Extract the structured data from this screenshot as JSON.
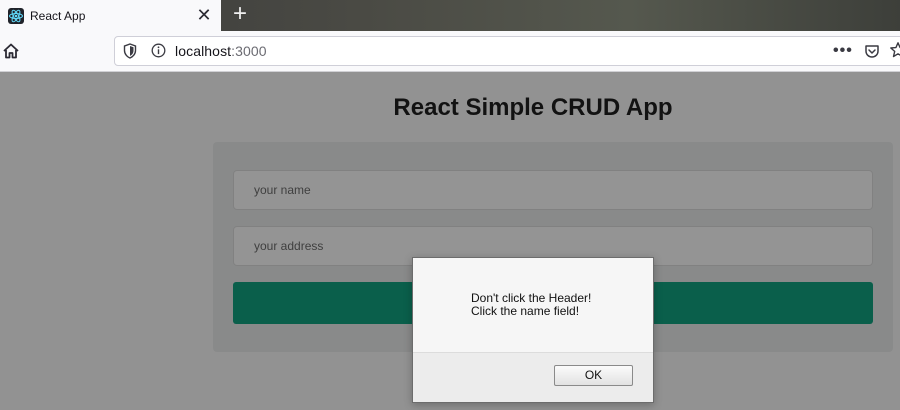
{
  "browser": {
    "tab": {
      "title": "React App",
      "icon": "react-logo-icon"
    },
    "url": {
      "host": "localhost",
      "port": ":3000"
    },
    "colors": {
      "accent": "#129e7e"
    }
  },
  "page": {
    "title": "React Simple CRUD App",
    "form": {
      "name_placeholder": "your name",
      "address_placeholder": "your address",
      "submit_label": ""
    }
  },
  "dialog": {
    "message": "Don't click the Header!\nClick the name field!",
    "ok_label": "OK"
  }
}
